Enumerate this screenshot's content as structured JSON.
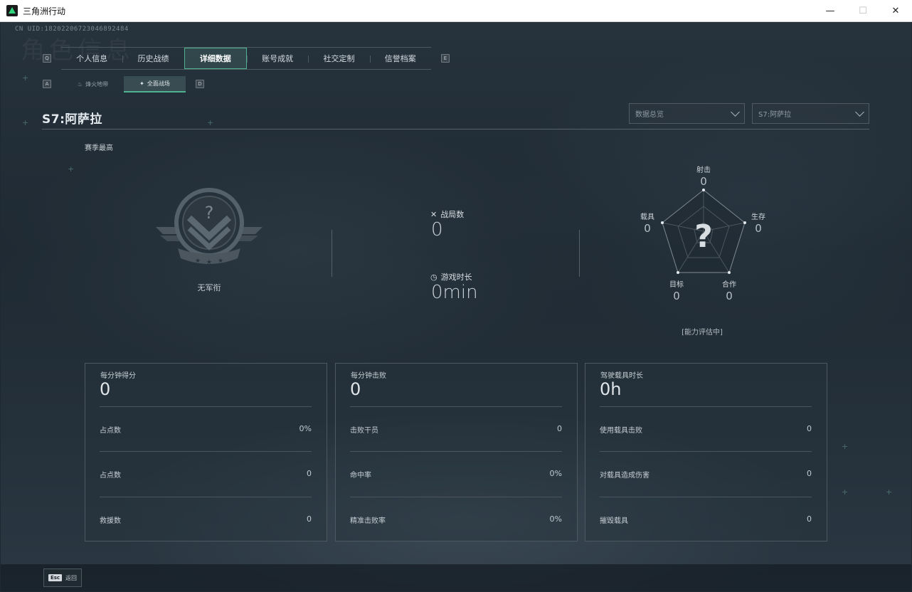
{
  "window": {
    "title": "三角洲行动",
    "minimize": "—",
    "maximize": "☐",
    "close": "✕"
  },
  "cnid": "CN UID:18202206723046892484",
  "watermark": "角色信息",
  "keys": {
    "prev_tab": "Q",
    "next_tab": "E",
    "prev_sub": "A",
    "next_sub": "D"
  },
  "main_tabs": [
    {
      "label": "个人信息",
      "active": false
    },
    {
      "label": "历史战绩",
      "active": false
    },
    {
      "label": "详细数据",
      "active": true
    },
    {
      "label": "账号成就",
      "active": false
    },
    {
      "label": "社交定制",
      "active": false
    },
    {
      "label": "信誉档案",
      "active": false
    }
  ],
  "sub_tabs": [
    {
      "label": "烽火地带",
      "active": false
    },
    {
      "label": "全面战场",
      "active": true
    }
  ],
  "header": {
    "season_title": "S7:阿萨拉",
    "dropdown_view": "数据总览",
    "dropdown_season": "S7:阿萨拉",
    "season_best": "赛季最高"
  },
  "rank": {
    "name": "无军衔",
    "symbol": "?"
  },
  "stats": {
    "matches_label": "战局数",
    "matches_value": "0",
    "playtime_label": "游戏时长",
    "playtime_value": "0min"
  },
  "radar": {
    "symbol": "?",
    "caption": "[能力评估中]",
    "axes": [
      {
        "label": "射击",
        "value": "0"
      },
      {
        "label": "生存",
        "value": "0"
      },
      {
        "label": "合作",
        "value": "0"
      },
      {
        "label": "目标",
        "value": "0"
      },
      {
        "label": "载具",
        "value": "0"
      }
    ]
  },
  "panels": [
    {
      "title": "每分钟得分",
      "value": "0",
      "rows": [
        {
          "label": "占点数",
          "value": "0%"
        },
        {
          "label": "占点数",
          "value": "0"
        },
        {
          "label": "救援数",
          "value": "0"
        }
      ]
    },
    {
      "title": "每分钟击败",
      "value": "0",
      "rows": [
        {
          "label": "击败干员",
          "value": "0"
        },
        {
          "label": "命中率",
          "value": "0%"
        },
        {
          "label": "精准击败率",
          "value": "0%"
        }
      ]
    },
    {
      "title": "驾驶载具时长",
      "value": "0h",
      "rows": [
        {
          "label": "使用载具击败",
          "value": "0"
        },
        {
          "label": "对载具造成伤害",
          "value": "0"
        },
        {
          "label": "摧毁载具",
          "value": "0"
        }
      ]
    }
  ],
  "footer": {
    "esc_key": "Esc",
    "back_label": "返回"
  },
  "colors": {
    "accent": "#4fb392",
    "background": "#1e2933"
  }
}
